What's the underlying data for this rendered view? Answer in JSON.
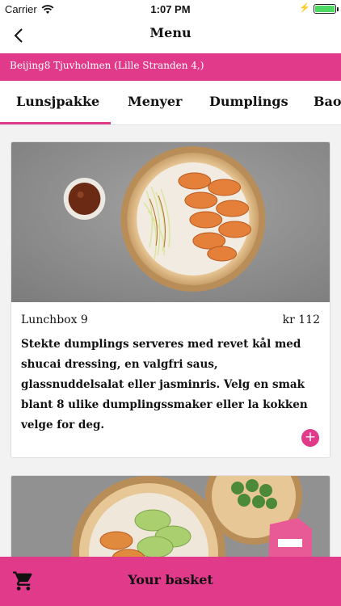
{
  "status_bar": {
    "carrier": "Carrier",
    "time": "1:07 PM"
  },
  "header": {
    "title": "Menu",
    "back_icon": "chevron-left-icon"
  },
  "location": {
    "name": "Beijing8 Tjuvholmen (Lille Stranden 4,)"
  },
  "tabs": [
    {
      "label": "Lunsjpakke",
      "active": true
    },
    {
      "label": "Menyer",
      "active": false
    },
    {
      "label": "Dumplings",
      "active": false
    },
    {
      "label": "Bao",
      "active": false
    }
  ],
  "items": [
    {
      "name": "Lunchbox 9",
      "price": "kr 112",
      "description": "Stekte dumplings serveres med revet kål med shucai dressing, en valgfri saus, glassnuddelsalat eller jasminris. Velg en smak blant 8 ulike dumplingssmaker eller la kokken velge for deg.",
      "add_icon": "plus-icon"
    }
  ],
  "basket": {
    "label": "Your basket",
    "icon": "cart-icon"
  },
  "colors": {
    "accent": "#e13a8a",
    "background": "#f2f2f2",
    "battery": "#4cd964"
  }
}
